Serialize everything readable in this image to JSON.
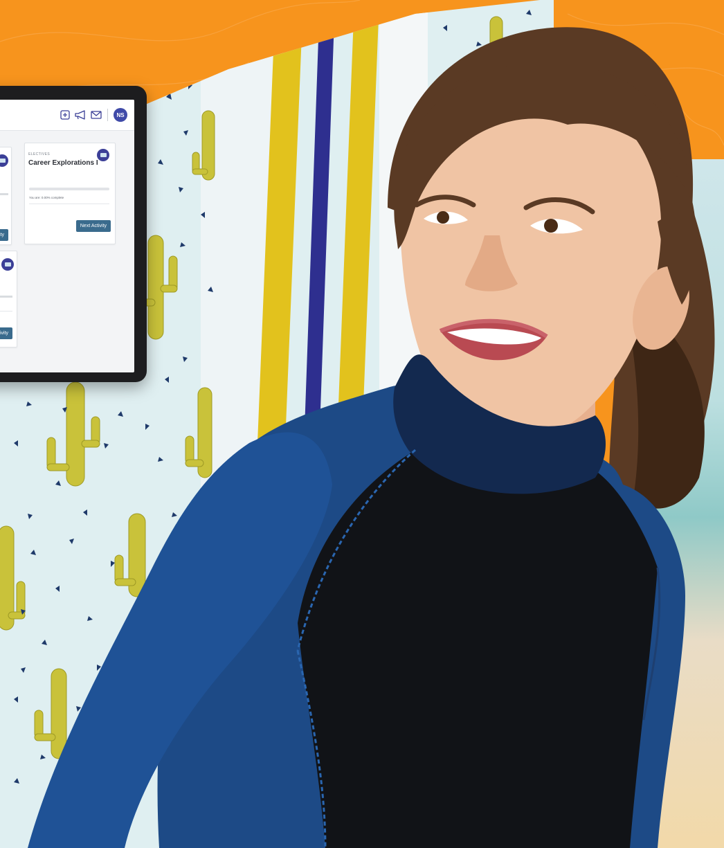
{
  "colors": {
    "orange": "#f7941d",
    "board_base": "#dfeff1",
    "stripe_yellow": "#e2c21d",
    "stripe_blue": "#2e2f8f",
    "cactus": "#c9c23a",
    "confetti": "#1f3a6a",
    "wetsuit_blue": "#1d4a86",
    "wetsuit_black": "#111317",
    "tablet_frame": "#1d1d1f",
    "button_blue": "#3a6b8d",
    "avatar_purple": "#3f4aa8"
  },
  "tablet": {
    "header": {
      "icons": [
        "add-square-icon",
        "megaphone-icon",
        "mail-icon"
      ],
      "avatar_initials": "NS"
    },
    "cards": [
      {
        "category": "ELECTIVES",
        "title": "Career Explorations I",
        "progress_text": "You are: 0.00% complete",
        "progress_percent": 0,
        "button_label": "Next Activity"
      },
      {
        "button_label": "ity"
      },
      {
        "button_label": "tivity"
      }
    ]
  }
}
